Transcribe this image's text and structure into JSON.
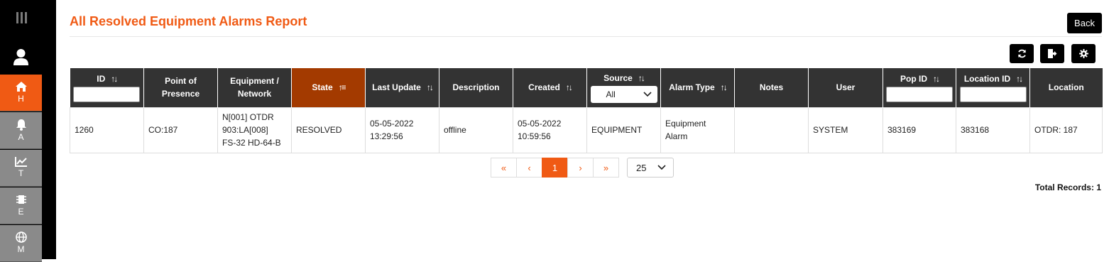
{
  "title": "All Resolved Equipment Alarms Report",
  "back_label": "Back",
  "sidebar": {
    "items": [
      {
        "label": "H",
        "icon": "home-icon",
        "active": true
      },
      {
        "label": "A",
        "icon": "bell-icon",
        "active": false
      },
      {
        "label": "T",
        "icon": "trend-chart-icon",
        "active": false
      },
      {
        "label": "E",
        "icon": "chip-icon",
        "active": false
      },
      {
        "label": "M",
        "icon": "globe-icon",
        "active": false
      }
    ]
  },
  "toolbar": {
    "refresh_icon": "refresh-icon",
    "export_icon": "export-icon",
    "settings_icon": "gear-icon"
  },
  "table": {
    "headers": {
      "id": "ID",
      "pop": "Point of Presence",
      "equipment": "Equipment / Network",
      "state": "State",
      "last_update": "Last Update",
      "description": "Description",
      "created": "Created",
      "source": "Source",
      "alarm_type": "Alarm Type",
      "notes": "Notes",
      "user": "User",
      "pop_id": "Pop ID",
      "location_id": "Location ID",
      "location": "Location"
    },
    "source_filter": "All",
    "rows": [
      {
        "id": "1260",
        "pop": "CO:187",
        "equipment_line1": "N[001] OTDR",
        "equipment_line2": "903:LA[008]",
        "equipment_line3": "FS-32 HD-64-B",
        "state": "RESOLVED",
        "last_update_date": "05-05-2022",
        "last_update_time": "13:29:56",
        "description": "offline",
        "created_date": "05-05-2022",
        "created_time": "10:59:56",
        "source": "EQUIPMENT",
        "alarm_type_line1": "Equipment",
        "alarm_type_line2": "Alarm",
        "notes": "",
        "user": "SYSTEM",
        "pop_id": "383169",
        "location_id": "383168",
        "location": "OTDR: 187"
      }
    ]
  },
  "pagination": {
    "first": "«",
    "prev": "‹",
    "current": "1",
    "next": "›",
    "last": "»",
    "page_size": "25"
  },
  "total_records": "Total Records: 1",
  "colors": {
    "accent": "#f05a14",
    "header_bg": "#333333",
    "sorted_header_bg": "#a33a00",
    "resolved": "#2e9e2e"
  }
}
